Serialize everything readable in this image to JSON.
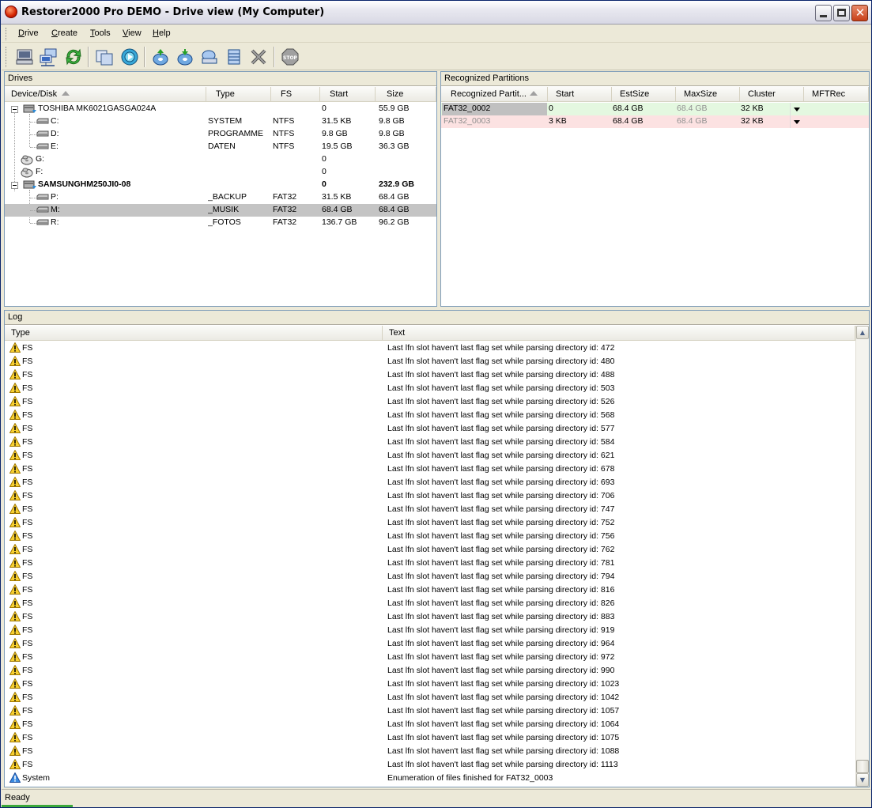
{
  "window": {
    "title": "Restorer2000 Pro DEMO - Drive view (My Computer)",
    "minimize": "minimize",
    "maximize": "maximize",
    "close": "✕"
  },
  "menu": [
    {
      "label": "Drive",
      "u": "D",
      "rest": "rive"
    },
    {
      "label": "Create",
      "u": "C",
      "rest": "reate"
    },
    {
      "label": "Tools",
      "u": "T",
      "rest": "ools"
    },
    {
      "label": "View",
      "u": "V",
      "rest": "iew"
    },
    {
      "label": "Help",
      "u": "H",
      "rest": "elp"
    }
  ],
  "toolbar_icons": [
    "local-computer-icon",
    "network-computer-icon",
    "refresh-icon",
    "copy-icon",
    "scan-icon",
    "open-drive-icon",
    "restore-icon",
    "find-drive-icon",
    "region-icon",
    "delete-icon",
    "stop-icon"
  ],
  "drives": {
    "title": "Drives",
    "columns": [
      "Device/Disk",
      "Type",
      "FS",
      "Start",
      "Size"
    ],
    "rows": [
      {
        "name": "TOSHIBA MK6021GASGA024A",
        "type": "",
        "fs": "",
        "start": "0",
        "size": "55.9 GB",
        "level": 0,
        "kind": "disk",
        "bold": false
      },
      {
        "name": "C:",
        "type": "SYSTEM",
        "fs": "NTFS",
        "start": "31.5 KB",
        "size": "9.8 GB",
        "level": 1,
        "kind": "drive"
      },
      {
        "name": "D:",
        "type": "PROGRAMME",
        "fs": "NTFS",
        "start": "9.8 GB",
        "size": "9.8 GB",
        "level": 1,
        "kind": "drive"
      },
      {
        "name": "E:",
        "type": "DATEN",
        "fs": "NTFS",
        "start": "19.5 GB",
        "size": "36.3 GB",
        "level": 1,
        "kind": "drive"
      },
      {
        "name": "G:",
        "type": "",
        "fs": "",
        "start": "0",
        "size": "",
        "level": 0,
        "kind": "cdrom"
      },
      {
        "name": "F:",
        "type": "",
        "fs": "",
        "start": "0",
        "size": "",
        "level": 0,
        "kind": "cdrom"
      },
      {
        "name": "SAMSUNGHM250JI0-08",
        "type": "",
        "fs": "",
        "start": "0",
        "size": "232.9 GB",
        "level": 0,
        "kind": "disk",
        "bold": true
      },
      {
        "name": "P:",
        "type": "_BACKUP",
        "fs": "FAT32",
        "start": "31.5 KB",
        "size": "68.4 GB",
        "level": 1,
        "kind": "drive"
      },
      {
        "name": "M:",
        "type": "_MUSIK",
        "fs": "FAT32",
        "start": "68.4 GB",
        "size": "68.4 GB",
        "level": 1,
        "kind": "drive",
        "selected": true
      },
      {
        "name": "R:",
        "type": "_FOTOS",
        "fs": "FAT32",
        "start": "136.7 GB",
        "size": "96.2 GB",
        "level": 1,
        "kind": "drive"
      }
    ]
  },
  "partitions": {
    "title": "Recognized Partitions",
    "columns": [
      "Recognized Partit...",
      "Start",
      "EstSize",
      "MaxSize",
      "Cluster",
      "MFTRec"
    ],
    "rows": [
      {
        "name": "FAT32_0002",
        "start": "0",
        "est": "68.4 GB",
        "max": "68.4 GB",
        "cluster": "32 KB",
        "mft": "",
        "bg": "#e4f8e0",
        "fg": "#000000"
      },
      {
        "name": "FAT32_0003",
        "start": "3 KB",
        "est": "68.4 GB",
        "max": "68.4 GB",
        "cluster": "32 KB",
        "mft": "",
        "bg": "#fce2e2",
        "fg": "#909090"
      }
    ]
  },
  "log": {
    "title": "Log",
    "columns": [
      "Type",
      "Text"
    ],
    "rows": [
      {
        "type": "FS",
        "text": "Last lfn slot haven't last flag set while parsing directory id: 472",
        "icon": "warning"
      },
      {
        "type": "FS",
        "text": "Last lfn slot haven't last flag set while parsing directory id: 480",
        "icon": "warning"
      },
      {
        "type": "FS",
        "text": "Last lfn slot haven't last flag set while parsing directory id: 488",
        "icon": "warning"
      },
      {
        "type": "FS",
        "text": "Last lfn slot haven't last flag set while parsing directory id: 503",
        "icon": "warning"
      },
      {
        "type": "FS",
        "text": "Last lfn slot haven't last flag set while parsing directory id: 526",
        "icon": "warning"
      },
      {
        "type": "FS",
        "text": "Last lfn slot haven't last flag set while parsing directory id: 568",
        "icon": "warning"
      },
      {
        "type": "FS",
        "text": "Last lfn slot haven't last flag set while parsing directory id: 577",
        "icon": "warning"
      },
      {
        "type": "FS",
        "text": "Last lfn slot haven't last flag set while parsing directory id: 584",
        "icon": "warning"
      },
      {
        "type": "FS",
        "text": "Last lfn slot haven't last flag set while parsing directory id: 621",
        "icon": "warning"
      },
      {
        "type": "FS",
        "text": "Last lfn slot haven't last flag set while parsing directory id: 678",
        "icon": "warning"
      },
      {
        "type": "FS",
        "text": "Last lfn slot haven't last flag set while parsing directory id: 693",
        "icon": "warning"
      },
      {
        "type": "FS",
        "text": "Last lfn slot haven't last flag set while parsing directory id: 706",
        "icon": "warning"
      },
      {
        "type": "FS",
        "text": "Last lfn slot haven't last flag set while parsing directory id: 747",
        "icon": "warning"
      },
      {
        "type": "FS",
        "text": "Last lfn slot haven't last flag set while parsing directory id: 752",
        "icon": "warning"
      },
      {
        "type": "FS",
        "text": "Last lfn slot haven't last flag set while parsing directory id: 756",
        "icon": "warning"
      },
      {
        "type": "FS",
        "text": "Last lfn slot haven't last flag set while parsing directory id: 762",
        "icon": "warning"
      },
      {
        "type": "FS",
        "text": "Last lfn slot haven't last flag set while parsing directory id: 781",
        "icon": "warning"
      },
      {
        "type": "FS",
        "text": "Last lfn slot haven't last flag set while parsing directory id: 794",
        "icon": "warning"
      },
      {
        "type": "FS",
        "text": "Last lfn slot haven't last flag set while parsing directory id: 816",
        "icon": "warning"
      },
      {
        "type": "FS",
        "text": "Last lfn slot haven't last flag set while parsing directory id: 826",
        "icon": "warning"
      },
      {
        "type": "FS",
        "text": "Last lfn slot haven't last flag set while parsing directory id: 883",
        "icon": "warning"
      },
      {
        "type": "FS",
        "text": "Last lfn slot haven't last flag set while parsing directory id: 919",
        "icon": "warning"
      },
      {
        "type": "FS",
        "text": "Last lfn slot haven't last flag set while parsing directory id: 964",
        "icon": "warning"
      },
      {
        "type": "FS",
        "text": "Last lfn slot haven't last flag set while parsing directory id: 972",
        "icon": "warning"
      },
      {
        "type": "FS",
        "text": "Last lfn slot haven't last flag set while parsing directory id: 990",
        "icon": "warning"
      },
      {
        "type": "FS",
        "text": "Last lfn slot haven't last flag set while parsing directory id: 1023",
        "icon": "warning"
      },
      {
        "type": "FS",
        "text": "Last lfn slot haven't last flag set while parsing directory id: 1042",
        "icon": "warning"
      },
      {
        "type": "FS",
        "text": "Last lfn slot haven't last flag set while parsing directory id: 1057",
        "icon": "warning"
      },
      {
        "type": "FS",
        "text": "Last lfn slot haven't last flag set while parsing directory id: 1064",
        "icon": "warning"
      },
      {
        "type": "FS",
        "text": "Last lfn slot haven't last flag set while parsing directory id: 1075",
        "icon": "warning"
      },
      {
        "type": "FS",
        "text": "Last lfn slot haven't last flag set while parsing directory id: 1088",
        "icon": "warning"
      },
      {
        "type": "FS",
        "text": "Last lfn slot haven't last flag set while parsing directory id: 1113",
        "icon": "warning"
      },
      {
        "type": "System",
        "text": "Enumeration of files finished for FAT32_0003",
        "icon": "info"
      }
    ]
  },
  "status": {
    "text": "Ready"
  }
}
